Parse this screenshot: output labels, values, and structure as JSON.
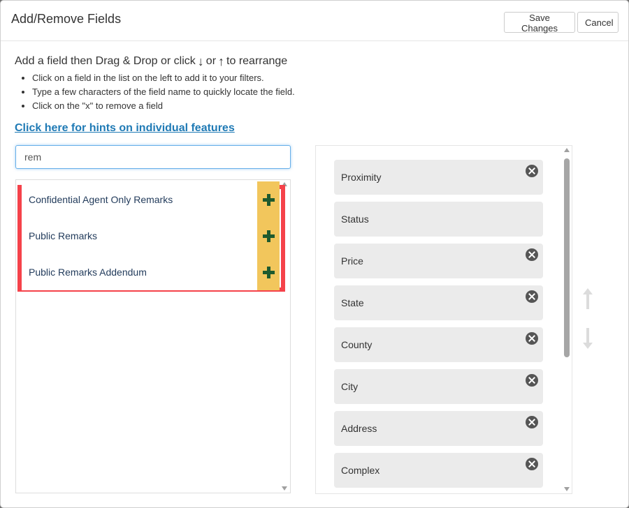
{
  "header": {
    "title": "Add/Remove Fields",
    "save_label": "Save Changes",
    "cancel_label": "Cancel"
  },
  "instructions": {
    "title_part1": "Add a field then Drag & Drop or click",
    "down_arrow": "↓",
    "or_text": "or",
    "up_arrow": "↑",
    "title_part2": "to rearrange",
    "bullets": [
      "Click on a field in the list on the left to add it to your filters.",
      "Type a few characters of the field name to quickly locate the field.",
      "Click on the \"x\" to remove a field"
    ],
    "hint_link": "Click here for hints on individual features"
  },
  "search": {
    "value": "rem",
    "placeholder": ""
  },
  "results": [
    {
      "label": "Confidential Agent Only Remarks"
    },
    {
      "label": "Public Remarks"
    },
    {
      "label": "Public Remarks Addendum"
    }
  ],
  "selected_fields": [
    {
      "label": "Proximity",
      "removable": true
    },
    {
      "label": "Status",
      "removable": false
    },
    {
      "label": "Price",
      "removable": true
    },
    {
      "label": "State",
      "removable": true
    },
    {
      "label": "County",
      "removable": true
    },
    {
      "label": "City",
      "removable": true
    },
    {
      "label": "Address",
      "removable": true
    },
    {
      "label": "Complex",
      "removable": true
    }
  ],
  "colors": {
    "highlight_border": "#f5424a",
    "add_button_bg": "#f2c65c",
    "plus_icon": "#1e5a2e",
    "link": "#1f7ab5",
    "field_bg": "#ebebeb"
  }
}
